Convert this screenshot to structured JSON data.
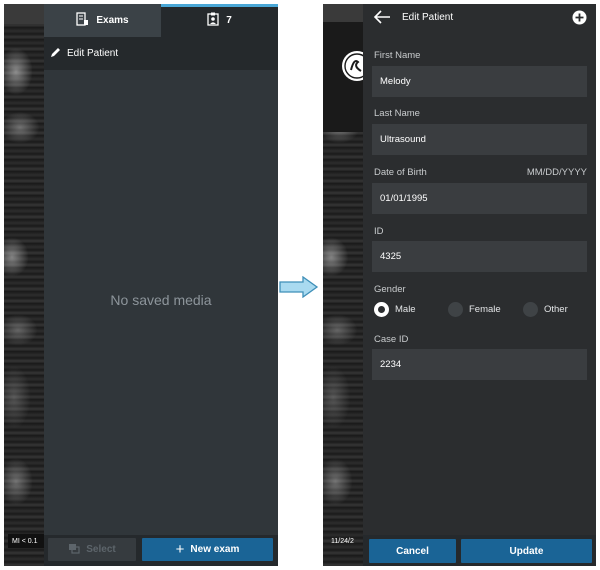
{
  "left_screen": {
    "tabs": [
      {
        "label": "Exams",
        "icon": "exam-list-icon"
      },
      {
        "label": "7",
        "icon": "clipboard-patient-icon"
      }
    ],
    "edit_patient_label": "Edit Patient",
    "empty_message": "No saved media",
    "select_label": "Select",
    "new_exam_label": "New exam",
    "mi_text": "MI < 0.1",
    "accent_color": "#4aa7d6"
  },
  "right_screen": {
    "title": "Edit Patient",
    "fields": {
      "first_name": {
        "label": "First Name",
        "value": "Melody"
      },
      "last_name": {
        "label": "Last Name",
        "value": "Ultrasound"
      },
      "dob": {
        "label": "Date of Birth",
        "format": "MM/DD/YYYY",
        "value": "01/01/1995"
      },
      "id": {
        "label": "ID",
        "value": "4325"
      },
      "case_id": {
        "label": "Case ID",
        "value": "2234"
      }
    },
    "gender": {
      "label": "Gender",
      "options": [
        "Male",
        "Female",
        "Other"
      ],
      "selected": "Male"
    },
    "cancel_label": "Cancel",
    "update_label": "Update",
    "date_text": "11/24/2",
    "button_color": "#1a6496"
  }
}
